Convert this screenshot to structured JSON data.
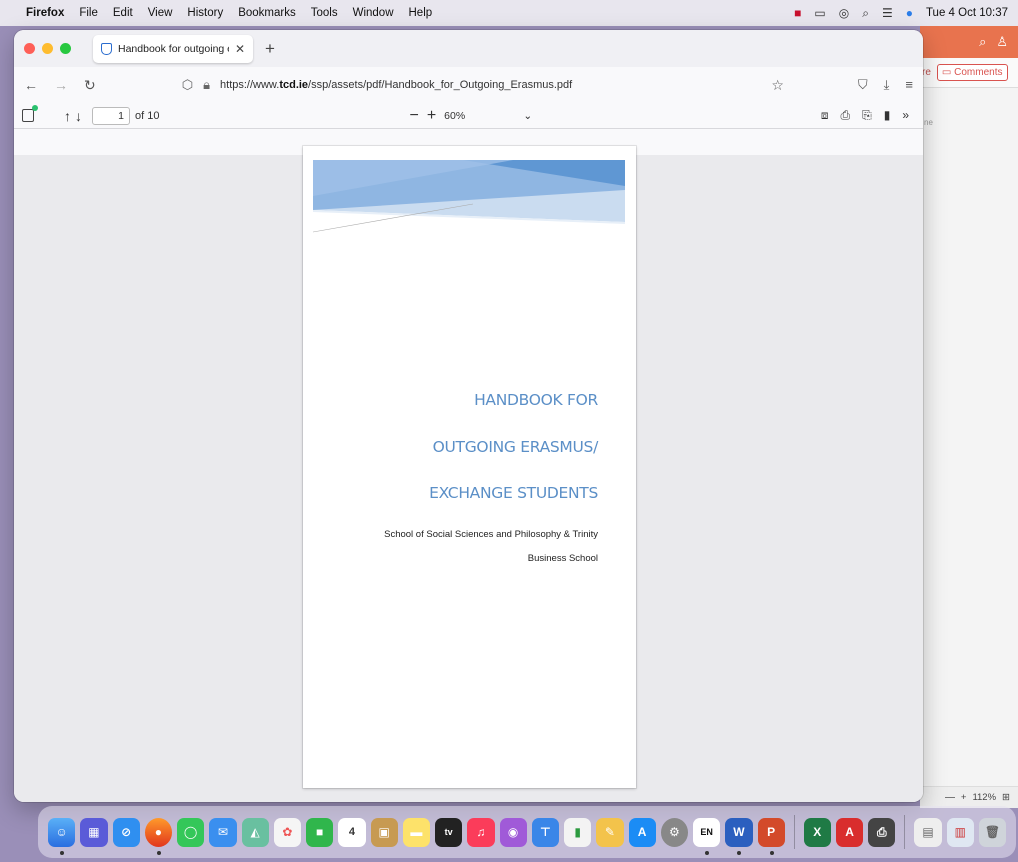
{
  "menubar": {
    "app_name": "Firefox",
    "items": [
      "File",
      "Edit",
      "View",
      "History",
      "Bookmarks",
      "Tools",
      "Window",
      "Help"
    ],
    "clock": "Tue 4 Oct  10:37"
  },
  "background_app": {
    "share_label": "re",
    "comments_label": "Comments",
    "sub_label": "ne",
    "zoom_level": "112%"
  },
  "browser": {
    "tab_title": "Handbook for outgoing erasmus",
    "url_prefix": "https://www.",
    "url_domain": "tcd.ie",
    "url_path": "/ssp/assets/pdf/Handbook_for_Outgoing_Erasmus.pdf"
  },
  "pdf_toolbar": {
    "page_number": "1",
    "page_total": "of 10",
    "zoom": "60%"
  },
  "document": {
    "title_line1": "HANDBOOK FOR",
    "title_line2": "OUTGOING ERASMUS/",
    "title_line3": "EXCHANGE STUDENTS",
    "subtitle_line1": "School of Social Sciences and Philosophy & Trinity",
    "subtitle_line2": "Business School"
  },
  "colors": {
    "title_blue": "#5b8fc7",
    "banner_blue": "#5f97d3"
  }
}
